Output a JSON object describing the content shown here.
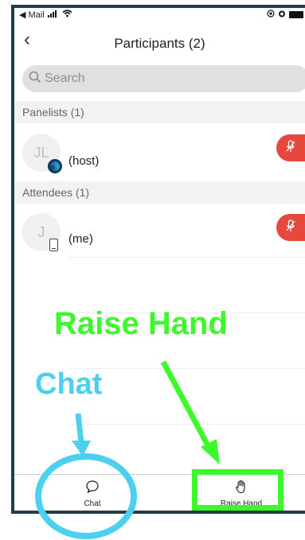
{
  "status_bar": {
    "back_app": "◀ Mail"
  },
  "nav": {
    "back_icon": "‹",
    "title": "Participants (2)"
  },
  "search": {
    "placeholder": "Search",
    "icon": "search-icon"
  },
  "sections": [
    {
      "title": "Panelists (1)"
    },
    {
      "title": "Attendees (1)"
    }
  ],
  "participants": [
    {
      "initials": "JL",
      "label": "(host)",
      "badge": "app-badge-icon"
    },
    {
      "initials": "J",
      "label": "(me)",
      "badge": "phone-icon"
    }
  ],
  "bottom_tabs": {
    "chat": {
      "label": "Chat",
      "icon": "chat-bubble-icon"
    },
    "raise_hand": {
      "label": "Raise Hand",
      "icon": "hand-icon"
    }
  },
  "annotations": {
    "raise_hand": "Raise Hand",
    "chat": "Chat",
    "green": "#3df82a",
    "cyan": "#4dd0f0"
  },
  "colors": {
    "mute_red": "#e8473d",
    "frame": "#1f3f47"
  }
}
